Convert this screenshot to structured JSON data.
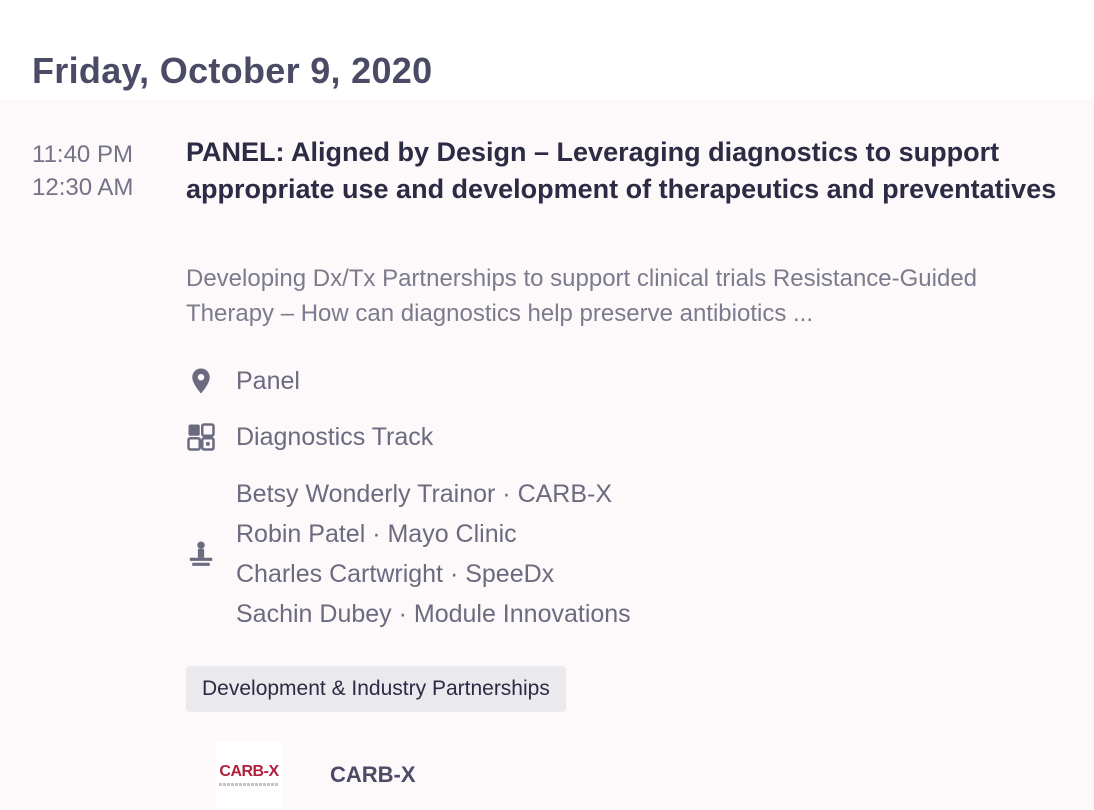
{
  "day": {
    "heading": "Friday, October 9, 2020"
  },
  "session": {
    "start_time": "11:40 PM",
    "end_time": "12:30 AM",
    "title": "PANEL: Aligned by Design – Leveraging diagnostics to support appropriate use and development of therapeutics and preventatives",
    "description": "Developing Dx/Tx Partnerships to support clinical trials  Resistance-Guided Therapy – How can diagnostics help preserve antibiotics ...",
    "location": {
      "icon": "location-pin-icon",
      "label": "Panel"
    },
    "track": {
      "icon": "track-grid-icon",
      "label": "Diagnostics Track"
    },
    "speakers_icon": "speaker-podium-icon",
    "speakers": [
      "Betsy Wonderly Trainor · CARB-X",
      "Robin Patel · Mayo Clinic",
      "Charles Cartwright · SpeeDx",
      "Sachin Dubey · Module Innovations"
    ],
    "tag": "Development & Industry Partnerships",
    "sponsor": {
      "logo_text": "CARB-X",
      "name": "CARB-X"
    }
  },
  "colors": {
    "heading": "#4b4b66",
    "title": "#2b2b44",
    "muted": "#737388",
    "card_background": "#fdf8f9",
    "tag_background": "#e9e9ee",
    "logo_red": "#b21f3a"
  }
}
